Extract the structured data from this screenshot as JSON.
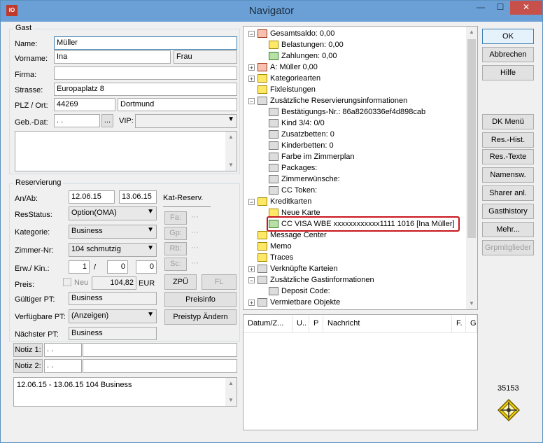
{
  "window": {
    "title": "Navigator",
    "app_icon": "IO",
    "minimize": "—",
    "maximize": "☐",
    "close": "✕"
  },
  "gast": {
    "group_title": "Gast",
    "name_label": "Name:",
    "name_value": "Müller",
    "vorname_label": "Vorname:",
    "vorname_value": "Ina",
    "anrede_value": "Frau",
    "firma_label": "Firma:",
    "firma_value": "",
    "strasse_label": "Strasse:",
    "strasse_value": "Europaplatz 8",
    "plzort_label": "PLZ / Ort:",
    "plz_value": "44269",
    "ort_value": "Dortmund",
    "gebdat_label": "Geb.-Dat:",
    "gebdat_value": " .  .",
    "gebdat_button": "...",
    "vip_label": "VIP:",
    "vip_value": ""
  },
  "reservierung": {
    "group_title": "Reservierung",
    "anab_label": "An/Ab:",
    "an_value": "12.06.15",
    "ab_value": "13.06.15",
    "katreserv_label": "Kat-Reserv.",
    "resstatus_label": "ResStatus:",
    "resstatus_value": "Option(OMA)",
    "kategorie_label": "Kategorie:",
    "kategorie_value": "Business",
    "zimmer_label": "Zimmer-Nr:",
    "zimmer_value": "104 schmutzig",
    "erwkin_label": "Erw./ Kin.:",
    "erw_value": "1",
    "slash": "/",
    "kin1_value": "0",
    "kin2_value": "0",
    "preis_label": "Preis:",
    "neu_label": "Neu",
    "preis_value": "104,82",
    "currency": "EUR",
    "gueltiger_label": "Gültiger PT:",
    "gueltiger_value": "Business",
    "verfuegbare_label": "Verfügbare PT:",
    "verfuegbare_value": "(Anzeigen)",
    "naechster_label": "Nächster PT:",
    "naechster_value": "Business",
    "fa_button": "Fa:",
    "gp_button": "Gp:",
    "rb_button": "Rb:",
    "sc_button": "Sc:",
    "dots": "···",
    "zpu_button": "ZPÜ",
    "fl_button": "FL",
    "preisinfo_button": "Preisinfo",
    "preistyp_button": "Preistyp Ändern"
  },
  "notiz": {
    "notiz1_button": "Notiz 1:",
    "notiz1_date": " .  .",
    "notiz1_text": "",
    "notiz2_button": "Notiz 2:",
    "notiz2_date": " .  .",
    "notiz2_text": "",
    "summary": "12.06.15 - 13.06.15   104 Business"
  },
  "tree": {
    "nodes": [
      {
        "label": "Gesamtsaldo: 0,00",
        "icon": "red"
      },
      {
        "label": "Belastungen: 0,00",
        "icon": "yellow"
      },
      {
        "label": "Zahlungen: 0,00",
        "icon": "green"
      },
      {
        "label": "A: Müller 0,00",
        "icon": "red"
      },
      {
        "label": "Kategoriearten",
        "icon": "yellow"
      },
      {
        "label": "Fixleistungen",
        "icon": "yellow"
      },
      {
        "label": "Zusätzliche Reservierungsinformationen",
        "icon": "gray"
      },
      {
        "label": "Bestätigungs-Nr.: 86a8260336ef4d898cab",
        "icon": "gray"
      },
      {
        "label": "Kind 3/4: 0/0",
        "icon": "gray"
      },
      {
        "label": "Zusatzbetten: 0",
        "icon": "gray"
      },
      {
        "label": "Kinderbetten: 0",
        "icon": "gray"
      },
      {
        "label": "Farbe im Zimmerplan",
        "icon": "gray"
      },
      {
        "label": "Packages:",
        "icon": "gray"
      },
      {
        "label": "Zimmerwünsche:",
        "icon": "gray"
      },
      {
        "label": "CC Token:",
        "icon": "gray"
      },
      {
        "label": "Kreditkarten",
        "icon": "yellow"
      },
      {
        "label": "Neue Karte",
        "icon": "yellow"
      },
      {
        "label": "CC VISA WBE xxxxxxxxxxxx1111 1016 [Ina Müller]",
        "icon": "green"
      },
      {
        "label": "Message Center",
        "icon": "yellow"
      },
      {
        "label": "Memo",
        "icon": "yellow"
      },
      {
        "label": "Traces",
        "icon": "yellow"
      },
      {
        "label": "Verknüpfte Karteien",
        "icon": "gray"
      },
      {
        "label": "Zusätzliche Gastinformationen",
        "icon": "gray"
      },
      {
        "label": "Deposit Code:",
        "icon": "gray"
      },
      {
        "label": "Vermietbare Objekte",
        "icon": "gray"
      }
    ]
  },
  "grid": {
    "columns": [
      "Datum/Z...",
      "U..",
      "P",
      "Nachricht",
      "F.",
      "G."
    ]
  },
  "buttons": {
    "ok": "OK",
    "abbrechen": "Abbrechen",
    "hilfe": "Hilfe",
    "dkmenu": "DK Menü",
    "reshist": "Res.-Hist.",
    "restexte": "Res.-Texte",
    "namensw": "Namensw.",
    "sharer": "Sharer anl.",
    "gasthistory": "Gasthistory",
    "mehr": "Mehr...",
    "grpmitglieder": "Grpmitglieder"
  },
  "status_number": "35153"
}
